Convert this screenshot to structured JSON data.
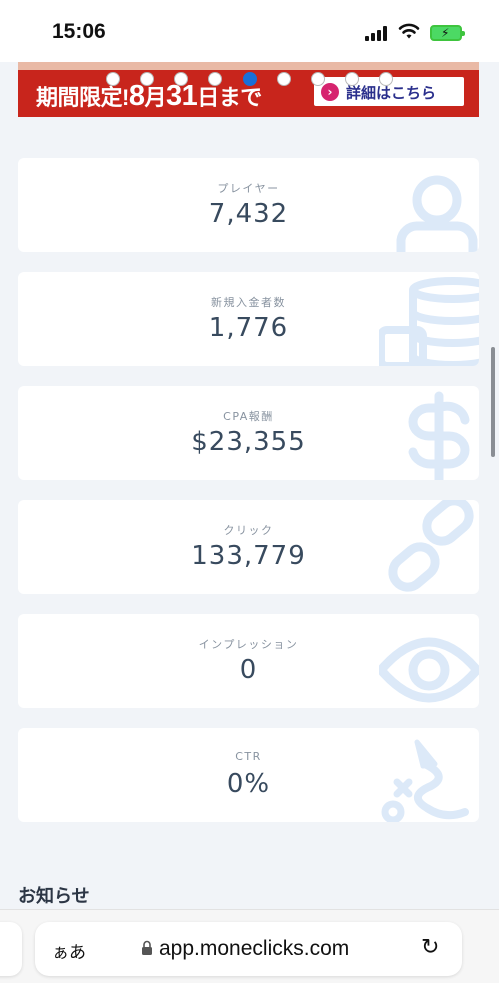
{
  "status_bar": {
    "time": "15:06"
  },
  "banner": {
    "promo_prefix": "期間限定!",
    "promo_month_num": "8",
    "promo_month_unit": "月",
    "promo_day_num": "31",
    "promo_suffix": "日まで",
    "detail_label": "詳細はこちら",
    "active_slide": 5
  },
  "stats": [
    {
      "label": "プレイヤー",
      "value": "7,432",
      "icon": "person-icon"
    },
    {
      "label": "新規入金者数",
      "value": "1,776",
      "icon": "coins-icon"
    },
    {
      "label": "CPA報酬",
      "value": "$23,355",
      "icon": "dollar-icon"
    },
    {
      "label": "クリック",
      "value": "133,779",
      "icon": "link-icon"
    },
    {
      "label": "インプレッション",
      "value": "0",
      "icon": "eye-icon"
    },
    {
      "label": "CTR",
      "value": "0%",
      "icon": "cursor-path-icon"
    }
  ],
  "news": {
    "title": "お知らせ"
  },
  "browser": {
    "aa_label": "ぁあ",
    "url": "app.moneclicks.com"
  },
  "colors": {
    "accent_icon": "#dce9f8",
    "banner_red": "#c8251c",
    "card_bg": "#ffffff",
    "page_bg": "#f1f4f8"
  }
}
